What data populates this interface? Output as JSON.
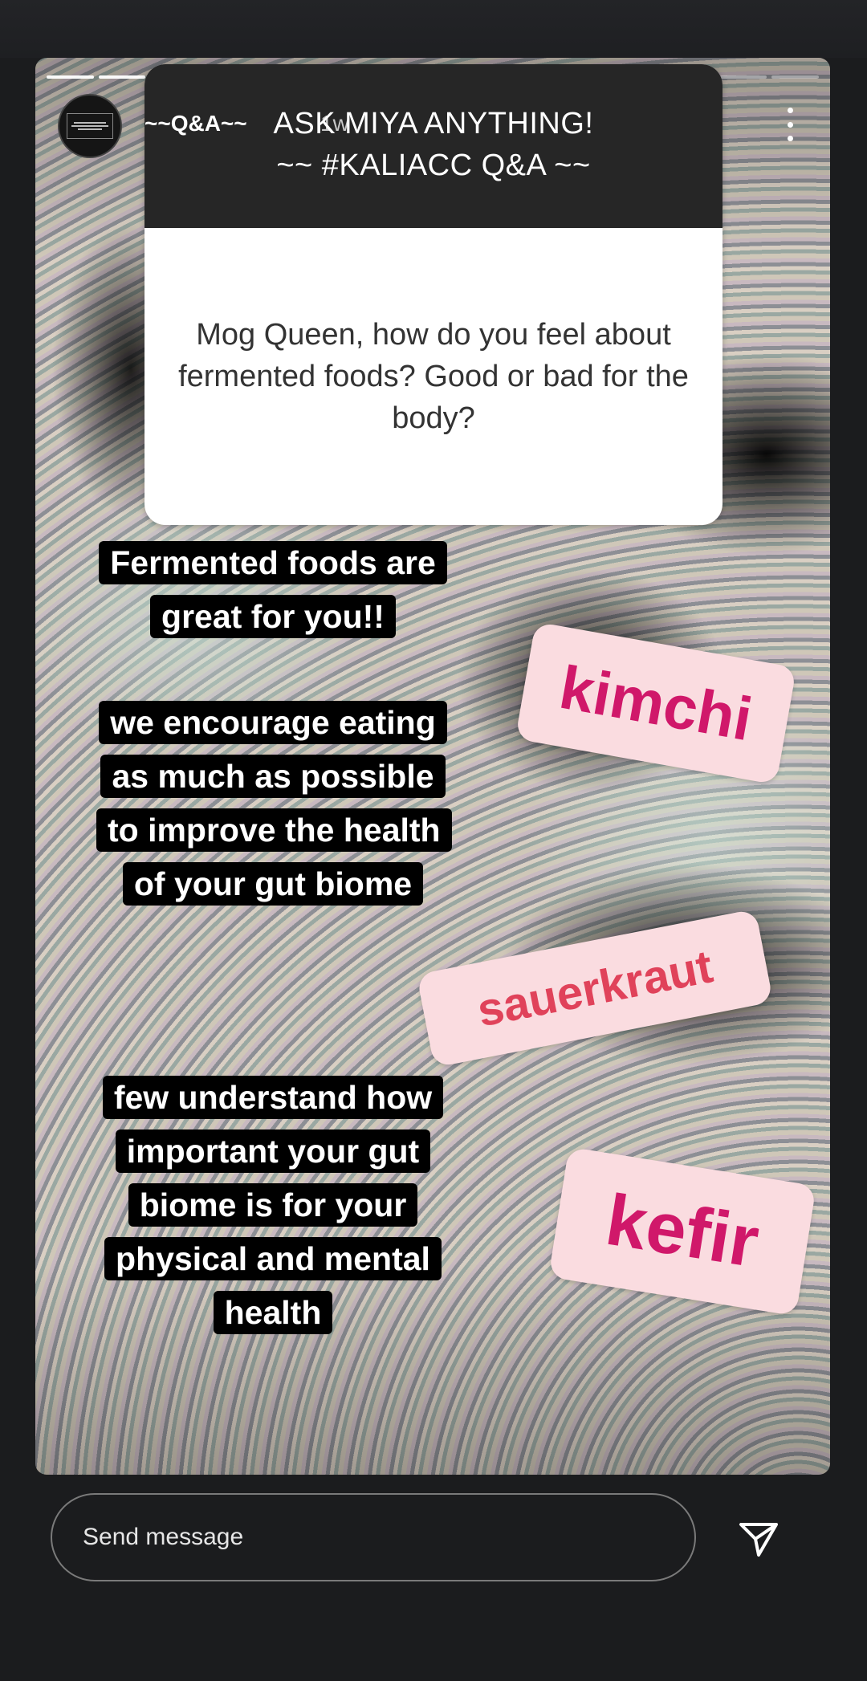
{
  "story": {
    "username": "~~Q&A~~",
    "time": "1w",
    "progress": {
      "segments": 15,
      "current": 4
    }
  },
  "question_box": {
    "title_line1": "ASK MIYA ANYTHING!",
    "title_line2": "~~ #KALIACC Q&A ~~",
    "question": "Mog Queen, how do you feel about fermented foods? Good or bad for the body?"
  },
  "captions": [
    "Fermented foods are great for you!!",
    "we encourage eating as much as possible to improve the health of your gut biome",
    "few understand how important your gut biome is for your physical and mental health"
  ],
  "stickers": {
    "kimchi": "kimchi",
    "sauerkraut": "sauerkraut",
    "kefir": "kefir"
  },
  "message_bar": {
    "placeholder": "Send message",
    "send_icon": "send-icon"
  },
  "colors": {
    "sticker_bg": "#fadce0",
    "sticker_text": "#d0186a",
    "sauerkraut_text": "#e0425a",
    "question_header": "#262626"
  }
}
